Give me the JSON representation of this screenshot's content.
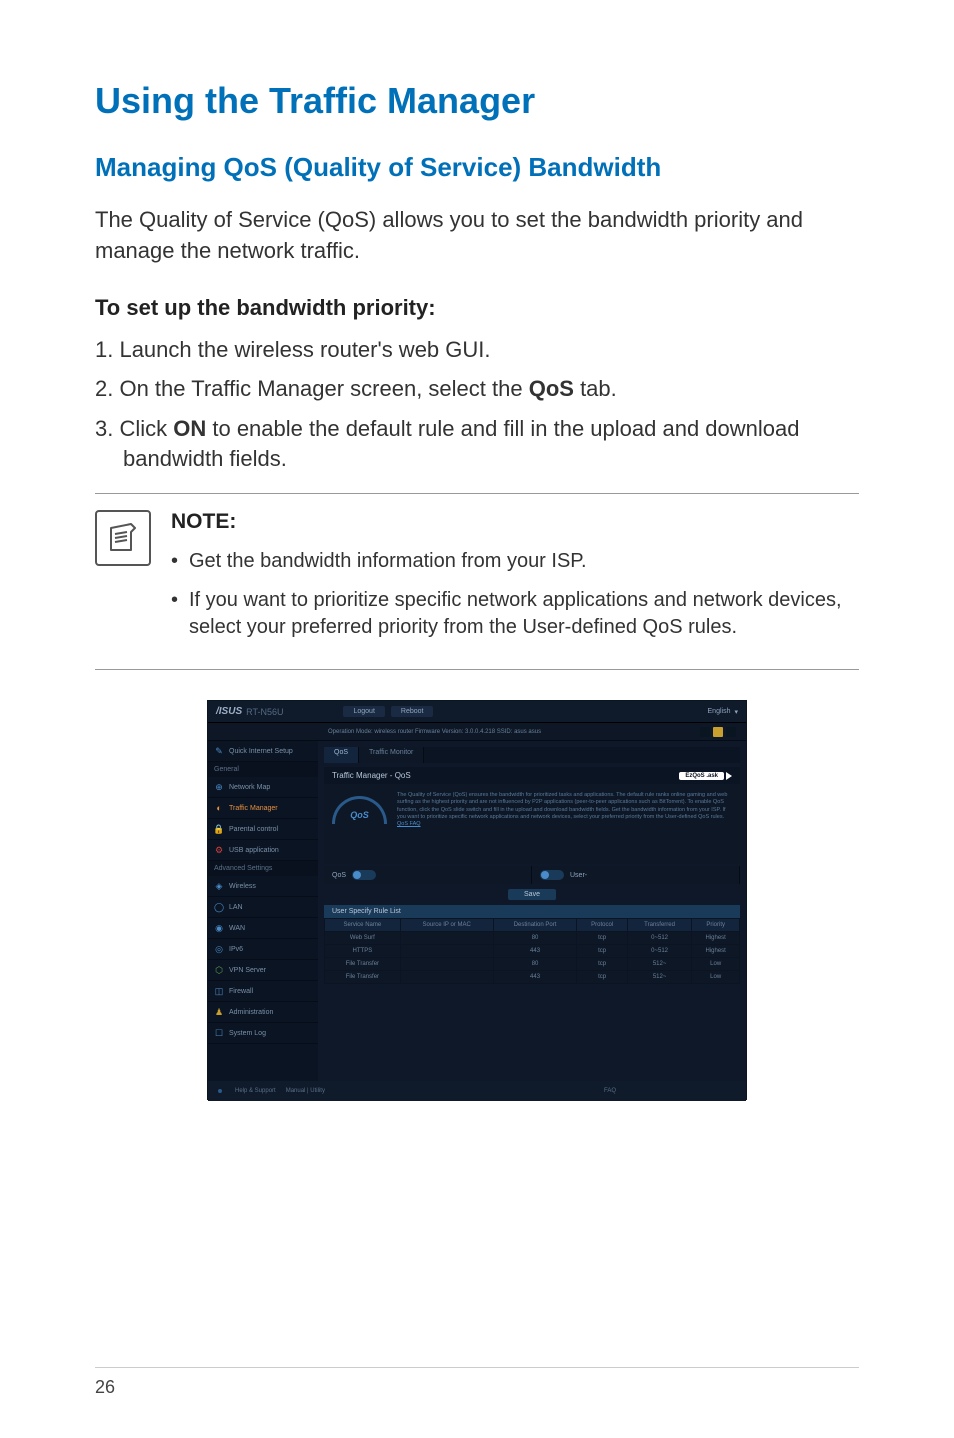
{
  "page": {
    "title": "Using the Traffic Manager",
    "subtitle": "Managing QoS (Quality of Service) Bandwidth",
    "intro": "The Quality of Service (QoS) allows you to set the bandwidth priority and manage the network traffic.",
    "steps_heading": "To set up the bandwidth priority:",
    "steps": {
      "s1_pre": "1.  Launch the wireless router's web GUI.",
      "s2_pre": "2.  On the Traffic Manager screen, select the ",
      "s2_bold": "QoS",
      "s2_post": " tab.",
      "s3_pre": "3.  Click ",
      "s3_bold": "ON",
      "s3_post": " to enable the default rule and fill in the upload and download bandwidth fields."
    },
    "note_label": "NOTE:",
    "note_items": {
      "n1": "Get the bandwidth information from your ISP.",
      "n2": "If you want to prioritize specific network applications and network devices, select your preferred priority from the User-defined QoS rules."
    },
    "page_number": "26"
  },
  "gui": {
    "brand": "/ISUS",
    "model": "RT-N56U",
    "header": {
      "logout": "Logout",
      "reboot": "Reboot",
      "language": "English",
      "caret": "▾"
    },
    "info_row": "Operation Mode: wireless router   Firmware Version: 3.0.0.4.218   SSID: asus  asus",
    "sidebar": {
      "quick_setup": "Quick Internet Setup",
      "sec_general": "General",
      "network_map": "Network Map",
      "traffic_manager": "Traffic Manager",
      "parental_control": "Parental control",
      "usb_application": "USB application",
      "sec_advanced": "Advanced Settings",
      "wireless": "Wireless",
      "lan": "LAN",
      "wan": "WAN",
      "ipv6": "IPv6",
      "vpn_server": "VPN Server",
      "firewall": "Firewall",
      "administration": "Administration",
      "system_log": "System Log"
    },
    "tabs": {
      "qos": "QoS",
      "traffic_monitor": "Traffic Monitor"
    },
    "panel": {
      "title": "Traffic Manager - QoS",
      "ezqos": "EzQoS .ask",
      "gauge": "QoS",
      "description": "The Quality of Service (QoS) ensures the bandwidth for prioritized tasks and applications. The default rule ranks online gaming and web surfing as the highest priority and are not influenced by P2P applications (peer-to-peer applications such as BitTorrent). To enable QoS function, click the QoS slide switch and fill in the upload and download bandwidth fields. Get the bandwidth information from your ISP. If you want to prioritize specific network applications and network devices, select your preferred priority from the User-defined QoS rules.",
      "faq_link": "QoS FAQ"
    },
    "controls": {
      "left_label": "QoS",
      "right_label": "User-",
      "save": "Save"
    },
    "rules": {
      "header": "User Specify Rule List",
      "cols": {
        "service": "Service Name",
        "source": "Source IP or MAC",
        "dest": "Destination Port",
        "protocol": "Protocol",
        "transferred": "Transferred",
        "priority": "Priority"
      },
      "rows": [
        {
          "service": "Web Surf",
          "source": "",
          "dest": "80",
          "protocol": "tcp",
          "transferred": "0~512",
          "priority": "Highest"
        },
        {
          "service": "HTTPS",
          "source": "",
          "dest": "443",
          "protocol": "tcp",
          "transferred": "0~512",
          "priority": "Highest"
        },
        {
          "service": "File Transfer",
          "source": "",
          "dest": "80",
          "protocol": "tcp",
          "transferred": "512~",
          "priority": "Low"
        },
        {
          "service": "File Transfer",
          "source": "",
          "dest": "443",
          "protocol": "tcp",
          "transferred": "512~",
          "priority": "Low"
        }
      ]
    },
    "footer": {
      "help": "Help & Support",
      "manual": "Manual | Utility",
      "faq": "FAQ"
    }
  }
}
